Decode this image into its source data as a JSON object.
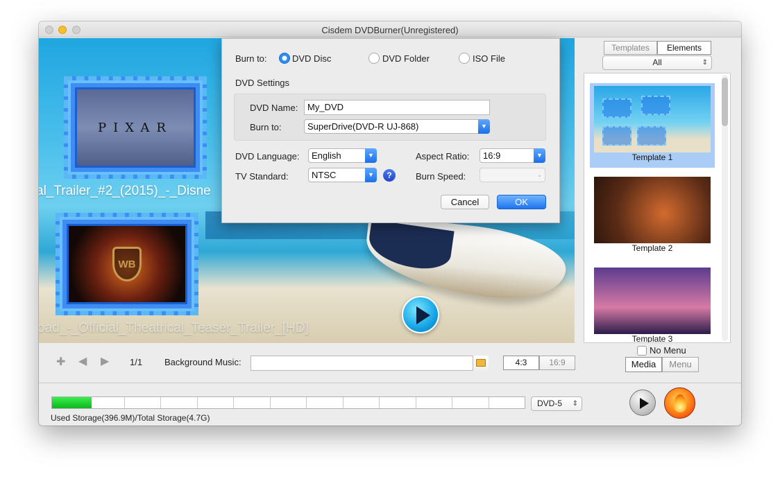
{
  "window": {
    "title": "Cisdem DVDBurner(Unregistered)"
  },
  "preview": {
    "clips": [
      {
        "title": "al_Trailer_#2_(2015)_-_Disne",
        "thumbnail": "pixar-logo",
        "logo_text": "PIXAR"
      },
      {
        "title": "oad_-_Official_Theatrical_Teaser_Trailer_[HD]",
        "thumbnail": "warner-bros-logo",
        "logo_text": "WB"
      }
    ],
    "play_icon": "play-icon"
  },
  "dialog": {
    "burn_to_label": "Burn to:",
    "options": [
      {
        "label": "DVD Disc",
        "selected": true
      },
      {
        "label": "DVD Folder",
        "selected": false
      },
      {
        "label": "ISO File",
        "selected": false
      }
    ],
    "settings_title": "DVD Settings",
    "dvd_name_label": "DVD Name:",
    "dvd_name_value": "My_DVD",
    "burner_label": "Burn to:",
    "burner_value": "SuperDrive(DVD-R   UJ-868)",
    "language_label": "DVD Language:",
    "language_value": "English",
    "aspect_label": "Aspect Ratio:",
    "aspect_value": "16:9",
    "tv_label": "TV Standard:",
    "tv_value": "NTSC",
    "speed_label": "Burn Speed:",
    "speed_value": "",
    "help_symbol": "?",
    "cancel_label": "Cancel",
    "ok_label": "OK"
  },
  "right_panel": {
    "tabs": [
      {
        "label": "Templates",
        "active": false
      },
      {
        "label": "Elements",
        "active": true
      }
    ],
    "filter_value": "All",
    "templates": [
      {
        "label": "Template 1",
        "selected": true
      },
      {
        "label": "Template 2",
        "selected": false
      },
      {
        "label": "Template 3",
        "selected": false
      }
    ],
    "no_menu_label": "No Menu",
    "bottom_tabs": [
      {
        "label": "Media",
        "active": true
      },
      {
        "label": "Menu",
        "active": false
      }
    ]
  },
  "toolbar": {
    "add_icon": "plus-icon",
    "prev_icon": "arrow-left-icon",
    "next_icon": "arrow-right-icon",
    "page": "1/1",
    "bg_music_label": "Background Music:",
    "bg_music_value": "",
    "ratio_options": [
      {
        "label": "4:3",
        "active": true
      },
      {
        "label": "16:9",
        "active": false
      }
    ]
  },
  "footer": {
    "storage_text": "Used Storage(396.9M)/Total Storage(4.7G)",
    "used_fraction": 0.084,
    "disc_type": "DVD-5",
    "play_icon": "play-icon",
    "burn_icon": "flame-icon"
  },
  "colors": {
    "accent": "#1f74ee",
    "progress": "#1fd12f",
    "selection": "#a9cdf7"
  }
}
